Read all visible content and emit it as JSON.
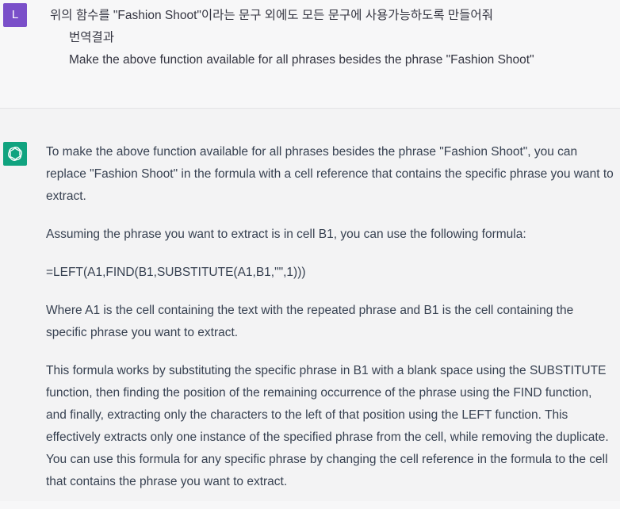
{
  "user": {
    "avatar_letter": "L",
    "avatar_color": "#7a4fc9",
    "message_korean": "위의 함수를 \"Fashion Shoot\"이라는 문구 외에도 모든 문구에 사용가능하도록 만들어줘",
    "translation_label": "번역결과",
    "message_english": "Make the above function available for all phrases besides the phrase \"Fashion Shoot\""
  },
  "assistant": {
    "avatar_icon": "openai-logo-icon",
    "avatar_color": "#10a37f",
    "paragraphs": [
      "To make the above function available for all phrases besides the phrase \"Fashion Shoot\", you can replace \"Fashion Shoot\" in the formula with a cell reference that contains the specific phrase you want to extract.",
      "Assuming the phrase you want to extract is in cell B1, you can use the following formula:",
      "=LEFT(A1,FIND(B1,SUBSTITUTE(A1,B1,\"\",1)))",
      "Where A1 is the cell containing the text with the repeated phrase and B1 is the cell containing the specific phrase you want to extract.",
      "This formula works by substituting the specific phrase in B1 with a blank space using the SUBSTITUTE function, then finding the position of the remaining occurrence of the phrase using the FIND function, and finally, extracting only the characters to the left of that position using the LEFT function. This effectively extracts only one instance of the specified phrase from the cell, while removing the duplicate. You can use this formula for any specific phrase by changing the cell reference in the formula to the cell that contains the phrase you want to extract."
    ]
  }
}
